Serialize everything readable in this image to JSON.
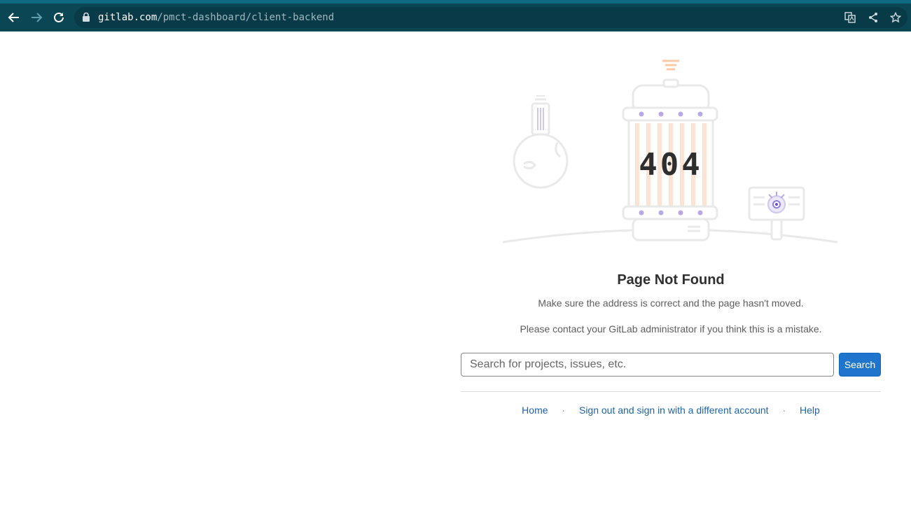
{
  "browser": {
    "url_host": "gitlab.com",
    "url_path": "/pmct-dashboard/client-backend",
    "icons": [
      "back-arrow-icon",
      "forward-arrow-icon",
      "reload-icon",
      "lock-icon",
      "translate-icon",
      "share-icon",
      "star-icon"
    ]
  },
  "illustration": {
    "code": "404"
  },
  "page": {
    "title": "Page Not Found",
    "message1": "Make sure the address is correct and the page hasn't moved.",
    "message2": "Please contact your GitLab administrator if you think this is a mistake."
  },
  "search": {
    "placeholder": "Search for projects, issues, etc.",
    "button_label": "Search"
  },
  "footer_links": {
    "home": "Home",
    "sign_out": "Sign out and sign in with a different account",
    "help": "Help",
    "separator": "·"
  },
  "colors": {
    "browser_bar": "#0b4655",
    "primary_button": "#1f75cb",
    "link": "#1f63a6"
  }
}
